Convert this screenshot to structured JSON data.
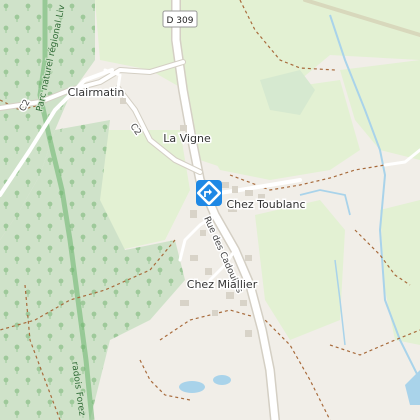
{
  "map": {
    "places": {
      "clairmatin": "Clairmatin",
      "la_vigne": "La Vigne",
      "chez_toublanc": "Chez Toublanc",
      "chez_miallier": "Chez Miallier"
    },
    "roads": {
      "d309": "D 309",
      "c2_north": "C2",
      "c2_south": "C2",
      "rue_des_cadoulles": "Rue des Cadoulles"
    },
    "park_labels": {
      "north": "Parc naturel régional Liv",
      "south": "radois Forez"
    },
    "marker_icon": "directions-marker-icon",
    "colors": {
      "forest": "#cfe2c9",
      "meadow": "#e3f1d3",
      "bare": "#f1eee8",
      "water": "#a9d3ea",
      "park_border": "#6ab46b",
      "marker": "#1e88e5"
    }
  }
}
